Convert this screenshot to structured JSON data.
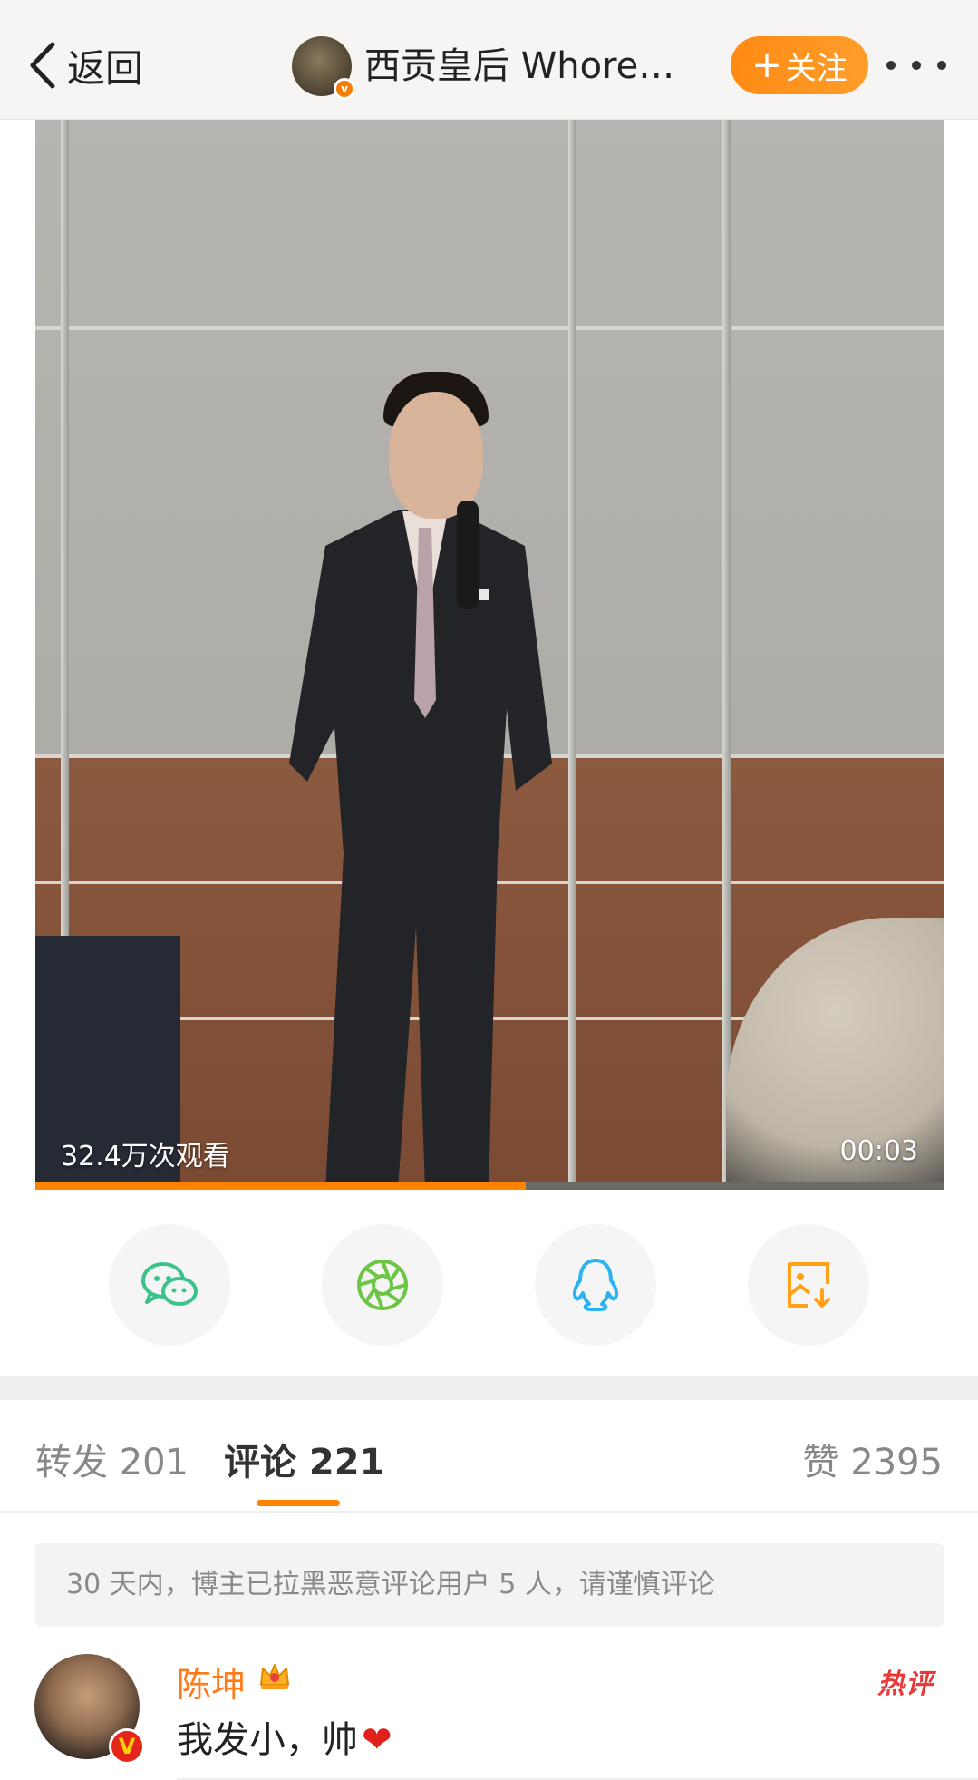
{
  "nav": {
    "back_label": "返回",
    "title": "西贡皇后 Whores...",
    "follow_label": "关注",
    "follow_icon": "plus-icon",
    "more_icon": "more-dots-icon",
    "avatar_badge": "v"
  },
  "video": {
    "views": "32.4万次观看",
    "duration": "00:03",
    "progress": 0.54
  },
  "share": {
    "items": [
      {
        "name": "wechat",
        "icon": "wechat-icon",
        "color": "#3cc28a"
      },
      {
        "name": "moments",
        "icon": "moments-icon",
        "color": "#6cc644"
      },
      {
        "name": "qq",
        "icon": "qq-icon",
        "color": "#2bb3f4"
      },
      {
        "name": "save-image",
        "icon": "save-image-icon",
        "color": "#ffa21a"
      }
    ]
  },
  "tabs": {
    "repost": "转发 201",
    "comment": "评论 221",
    "like": "赞 2395"
  },
  "notice": "30 天内，博主已拉黑恶意评论用户 5 人，请谨慎评论",
  "comment": {
    "username": "陈坤",
    "badge": "V",
    "text": "我发小，帅",
    "heart": "❤",
    "hot_label": "热评"
  },
  "colors": {
    "accent": "#ff8200",
    "username": "#ff7a1a",
    "hot": "#e83a3a"
  }
}
